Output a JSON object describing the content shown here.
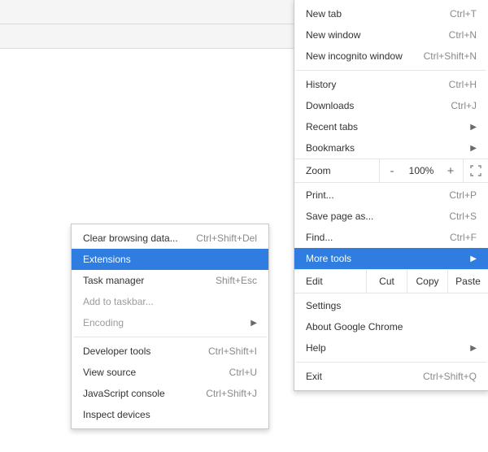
{
  "menu": {
    "new_tab": "New tab",
    "new_tab_k": "Ctrl+T",
    "new_window": "New window",
    "new_window_k": "Ctrl+N",
    "incognito": "New incognito window",
    "incognito_k": "Ctrl+Shift+N",
    "history": "History",
    "history_k": "Ctrl+H",
    "downloads": "Downloads",
    "downloads_k": "Ctrl+J",
    "recent_tabs": "Recent tabs",
    "bookmarks": "Bookmarks",
    "zoom": "Zoom",
    "zoom_minus": "-",
    "zoom_pct": "100%",
    "zoom_plus": "+",
    "print": "Print...",
    "print_k": "Ctrl+P",
    "save_as": "Save page as...",
    "save_as_k": "Ctrl+S",
    "find": "Find...",
    "find_k": "Ctrl+F",
    "more_tools": "More tools",
    "edit": "Edit",
    "cut": "Cut",
    "copy": "Copy",
    "paste": "Paste",
    "settings": "Settings",
    "about": "About Google Chrome",
    "help": "Help",
    "exit": "Exit",
    "exit_k": "Ctrl+Shift+Q"
  },
  "sub": {
    "clear": "Clear browsing data...",
    "clear_k": "Ctrl+Shift+Del",
    "extensions": "Extensions",
    "task_mgr": "Task manager",
    "task_mgr_k": "Shift+Esc",
    "add_tb": "Add to taskbar...",
    "encoding": "Encoding",
    "dev_tools": "Developer tools",
    "dev_tools_k": "Ctrl+Shift+I",
    "view_src": "View source",
    "view_src_k": "Ctrl+U",
    "js_console": "JavaScript console",
    "js_console_k": "Ctrl+Shift+J",
    "inspect": "Inspect devices"
  }
}
